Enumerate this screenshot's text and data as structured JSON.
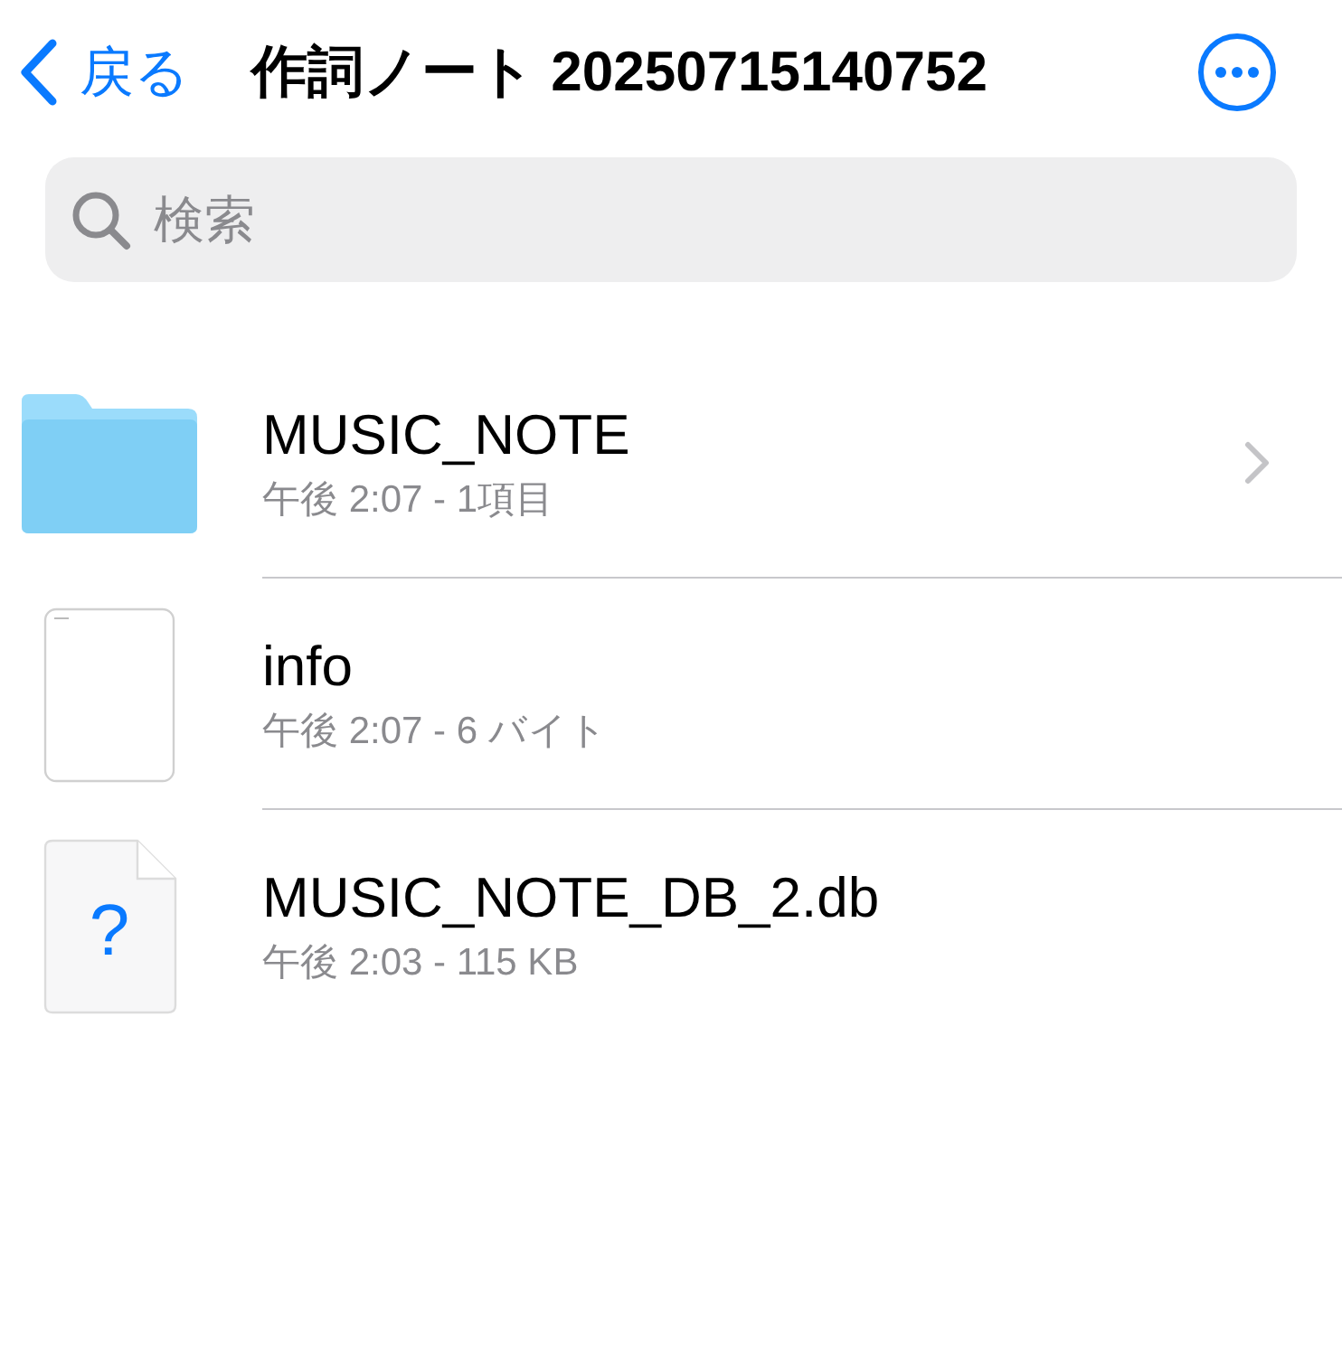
{
  "nav": {
    "back": "戻る",
    "title": "作詞ノート 20250715140752"
  },
  "search": {
    "placeholder": "検索"
  },
  "items": [
    {
      "kind": "folder",
      "name": "MUSIC_NOTE",
      "detail": "午後 2:07 - 1項目"
    },
    {
      "kind": "text",
      "name": "info",
      "detail": "午後 2:07 - 6 バイト"
    },
    {
      "kind": "unknown",
      "glyph": "?",
      "name": "MUSIC_NOTE_DB_2.db",
      "detail": "午後 2:03 - 115 KB"
    }
  ]
}
